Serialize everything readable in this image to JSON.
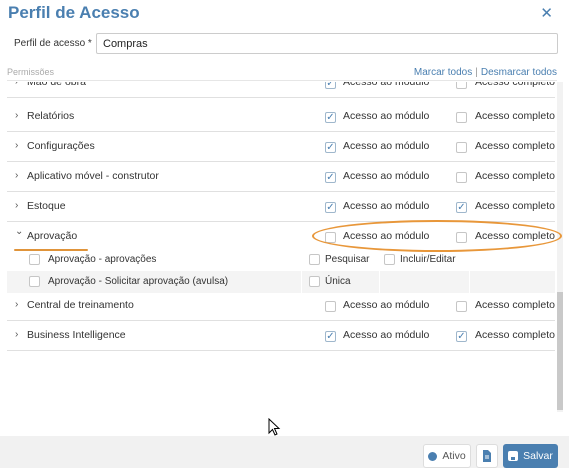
{
  "dialog": {
    "title": "Perfil de Acesso"
  },
  "profile": {
    "label": "Perfil de acesso *",
    "value": "Compras"
  },
  "permissions": {
    "label": "Permissões",
    "select_all": "Marcar todos",
    "separator": "|",
    "deselect_all": "Desmarcar todos"
  },
  "modules": [
    {
      "name": "Mão de obra",
      "module_access": "Acesso ao módulo",
      "module_checked": true,
      "full_access": "Acesso completo",
      "full_checked": false
    },
    {
      "name": "Relatórios",
      "module_access": "Acesso ao módulo",
      "module_checked": true,
      "full_access": "Acesso completo",
      "full_checked": false
    },
    {
      "name": "Configurações",
      "module_access": "Acesso ao módulo",
      "module_checked": true,
      "full_access": "Acesso completo",
      "full_checked": false
    },
    {
      "name": "Aplicativo móvel - construtor",
      "module_access": "Acesso ao módulo",
      "module_checked": true,
      "full_access": "Acesso completo",
      "full_checked": false
    },
    {
      "name": "Estoque",
      "module_access": "Acesso ao módulo",
      "module_checked": true,
      "full_access": "Acesso completo",
      "full_checked": true
    },
    {
      "name": "Aprovação",
      "module_access": "Acesso ao módulo",
      "module_checked": false,
      "full_access": "Acesso completo",
      "full_checked": false,
      "expanded": true
    },
    {
      "name": "Central de treinamento",
      "module_access": "Acesso ao módulo",
      "module_checked": false,
      "full_access": "Acesso completo",
      "full_checked": false
    },
    {
      "name": "Business Intelligence",
      "module_access": "Acesso ao módulo",
      "module_checked": true,
      "full_access": "Acesso completo",
      "full_checked": true
    }
  ],
  "sub_permissions": [
    {
      "name": "Aprovação - aprovações",
      "opt1": "Pesquisar",
      "opt2": "Incluir/Editar"
    },
    {
      "name": "Aprovação - Solicitar aprovação (avulsa)",
      "opt1": "Única"
    }
  ],
  "footer": {
    "active_label": "Ativo",
    "save_label": "Salvar"
  },
  "icons": {
    "close": "close-icon",
    "chevron": "chevron-right-icon",
    "check": "check-icon"
  },
  "colors": {
    "accent": "#4a7fb0",
    "highlight": "#e8973a"
  }
}
